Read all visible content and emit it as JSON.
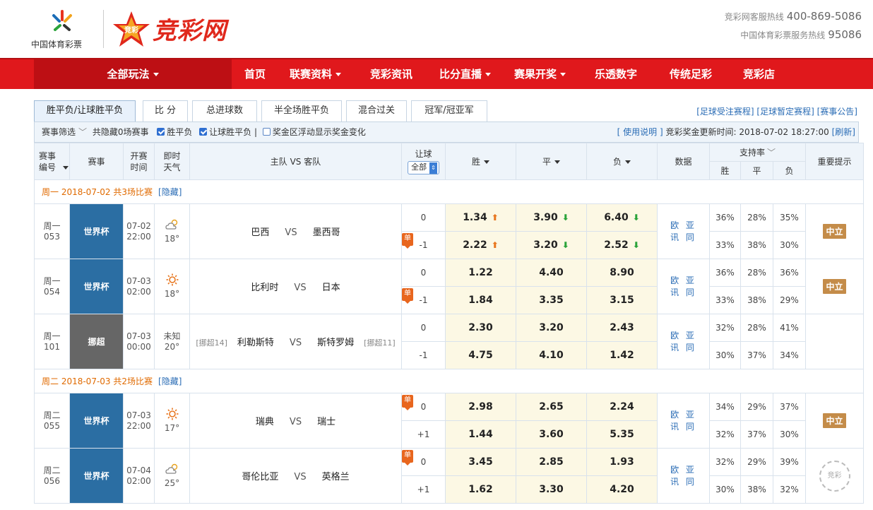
{
  "header": {
    "org_name": "中国体育彩票",
    "brand_badge": "竞彩",
    "brand_name": "竞彩网",
    "hotline1_label": "竞彩网客服热线",
    "hotline1_number": "400-869-5086",
    "hotline2_label": "中国体育彩票服务热线",
    "hotline2_number": "95086"
  },
  "nav": {
    "all_games": "全部玩法",
    "items": [
      "首页",
      "联赛资料",
      "竞彩资讯",
      "比分直播",
      "赛果开奖",
      "乐透数字",
      "传统足彩",
      "竞彩店"
    ]
  },
  "tabs": [
    "胜平负/让球胜平负",
    "比 分",
    "总进球数",
    "半全场胜平负",
    "混合过关",
    "冠军/冠亚军"
  ],
  "top_links": [
    "[足球受注赛程]",
    "[足球暂定赛程]",
    "[赛事公告]"
  ],
  "filter": {
    "label": "赛事筛选",
    "hidden": "共隐藏0场赛事",
    "cb1": "胜平负",
    "cb2": "让球胜平负 |",
    "cb3": "奖金区浮动显示奖金变化",
    "help": "[ 使用说明 ]",
    "update_label": "竞彩奖金更新时间: 2018-07-02 18:27:00",
    "refresh": "[刷新]"
  },
  "table_header": {
    "num": "赛事编号",
    "league": "赛事",
    "time": "开赛时间",
    "weather": "即时天气",
    "teams": "主队 VS 客队",
    "rq": "让球",
    "rq_select": "全部",
    "win": "胜",
    "draw": "平",
    "lose": "负",
    "data": "数据",
    "support": "支持率",
    "s_win": "胜",
    "s_draw": "平",
    "s_lose": "负",
    "tips": "重要提示"
  },
  "days": [
    {
      "label": "周一 2018-07-02  共3场比赛",
      "hide": "[隐藏]"
    },
    {
      "label": "周二 2018-07-03  共2场比赛",
      "hide": "[隐藏]"
    }
  ],
  "matches": [
    {
      "num1": "周一",
      "num2": "053",
      "league": "世界杯",
      "date": "07-02",
      "time": "22:00",
      "weather_icon": "partly-cloudy-icon",
      "temp": "18°",
      "home": "巴西",
      "vs": "VS",
      "away": "墨西哥",
      "rq1": "0",
      "rq2": "-1",
      "dan_row": 2,
      "o1": [
        "1.34",
        "3.90",
        "6.40"
      ],
      "o1_trend": [
        "up",
        "down",
        "down"
      ],
      "o2": [
        "2.22",
        "3.20",
        "2.52"
      ],
      "o2_trend": [
        "up",
        "down",
        "down"
      ],
      "data": "欧 亚 讯 同",
      "s1": [
        "36%",
        "28%",
        "35%"
      ],
      "s2": [
        "33%",
        "38%",
        "30%"
      ],
      "tip": "中立"
    },
    {
      "num1": "周一",
      "num2": "054",
      "league": "世界杯",
      "date": "07-03",
      "time": "02:00",
      "weather_icon": "sunny-icon",
      "temp": "18°",
      "home": "比利时",
      "vs": "VS",
      "away": "日本",
      "rq1": "0",
      "rq2": "-1",
      "dan_row": 2,
      "o1": [
        "1.22",
        "4.40",
        "8.90"
      ],
      "o2": [
        "1.84",
        "3.35",
        "3.15"
      ],
      "data": "欧 亚 讯 同",
      "s1": [
        "36%",
        "28%",
        "36%"
      ],
      "s2": [
        "33%",
        "38%",
        "29%"
      ],
      "tip": "中立"
    },
    {
      "num1": "周一",
      "num2": "101",
      "league": "挪超",
      "date": "07-03",
      "time": "00:00",
      "weather_text": "未知",
      "temp": "20°",
      "home_rank": "[挪超14]",
      "home": "利勒斯特",
      "vs": "VS",
      "away": "斯特罗姆",
      "away_rank": "[挪超11]",
      "rq1": "0",
      "rq2": "-1",
      "dan_row": 0,
      "o1": [
        "2.30",
        "3.20",
        "2.43"
      ],
      "o2": [
        "4.75",
        "4.10",
        "1.42"
      ],
      "data": "欧 亚 讯 同",
      "s1": [
        "32%",
        "28%",
        "41%"
      ],
      "s2": [
        "30%",
        "37%",
        "34%"
      ],
      "tip": ""
    },
    {
      "num1": "周二",
      "num2": "055",
      "league": "世界杯",
      "date": "07-03",
      "time": "22:00",
      "weather_icon": "sunny-icon",
      "temp": "17°",
      "home": "瑞典",
      "vs": "VS",
      "away": "瑞士",
      "rq1": "0",
      "rq2": "+1",
      "dan_row": 1,
      "o1": [
        "2.98",
        "2.65",
        "2.24"
      ],
      "o2": [
        "1.44",
        "3.60",
        "5.35"
      ],
      "data": "欧 亚 讯 同",
      "s1": [
        "34%",
        "29%",
        "37%"
      ],
      "s2": [
        "32%",
        "37%",
        "30%"
      ],
      "tip": "中立"
    },
    {
      "num1": "周二",
      "num2": "056",
      "league": "世界杯",
      "date": "07-04",
      "time": "02:00",
      "weather_icon": "partly-cloudy-icon",
      "temp": "25°",
      "home": "哥伦比亚",
      "vs": "VS",
      "away": "英格兰",
      "rq1": "0",
      "rq2": "+1",
      "dan_row": 1,
      "o1": [
        "3.45",
        "2.85",
        "1.93"
      ],
      "o2": [
        "1.62",
        "3.30",
        "4.20"
      ],
      "data": "欧 亚 讯 同",
      "s1": [
        "32%",
        "29%",
        "39%"
      ],
      "s2": [
        "30%",
        "38%",
        "32%"
      ],
      "tip": "",
      "seal": "竞彩"
    }
  ],
  "colors": {
    "nav_red": "#e0181c",
    "nav_dark": "#bd0f14",
    "world_cup": "#2b6ea3",
    "odds_bg": "#fcf8e4",
    "neutral": "#c48c49"
  }
}
